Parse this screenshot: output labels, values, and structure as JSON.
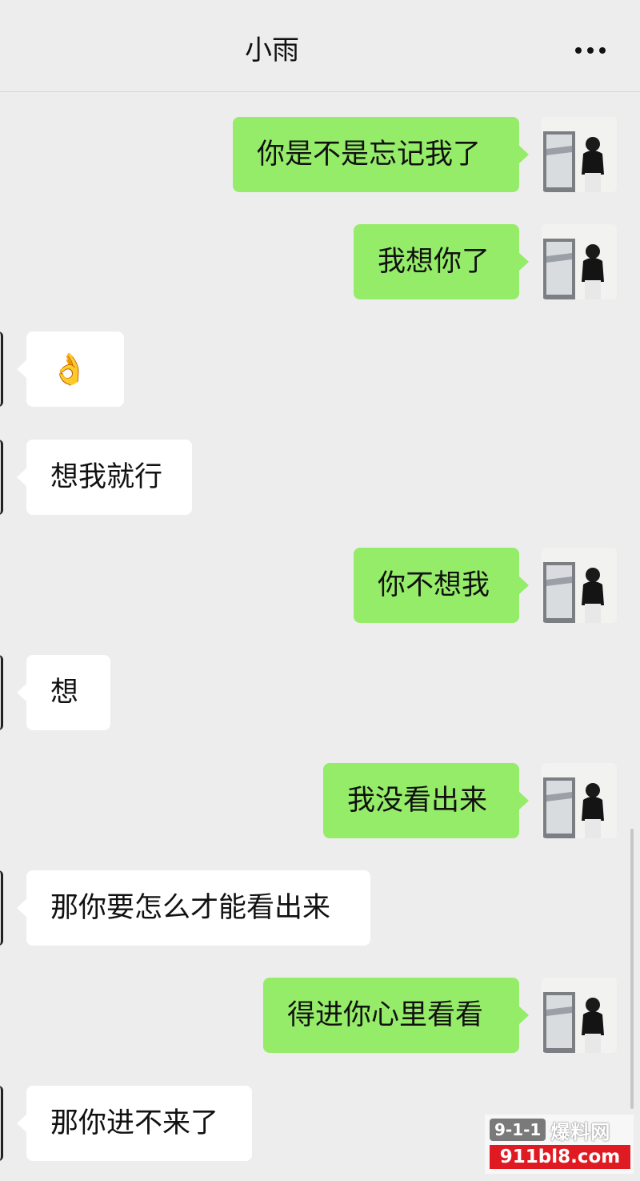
{
  "header": {
    "title": "小雨",
    "more_icon": "more-dots-icon"
  },
  "messages": [
    {
      "dir": "out",
      "text": "你是不是忘记我了"
    },
    {
      "dir": "out",
      "text": "我想你了"
    },
    {
      "dir": "in",
      "text": "👌"
    },
    {
      "dir": "in",
      "text": "想我就行"
    },
    {
      "dir": "out",
      "text": "你不想我"
    },
    {
      "dir": "in",
      "text": "想"
    },
    {
      "dir": "out",
      "text": "我没看出来"
    },
    {
      "dir": "in",
      "text": "那你要怎么才能看出来"
    },
    {
      "dir": "out",
      "text": "得进你心里看看"
    },
    {
      "dir": "in",
      "text": "那你进不来了"
    }
  ],
  "watermark": {
    "badge": "9-1-1",
    "name": "爆料网",
    "url": "911bl8.com"
  },
  "colors": {
    "outgoing_bubble": "#95ec69",
    "incoming_bubble": "#ffffff",
    "background": "#ededed",
    "watermark_red": "#e01a22"
  }
}
